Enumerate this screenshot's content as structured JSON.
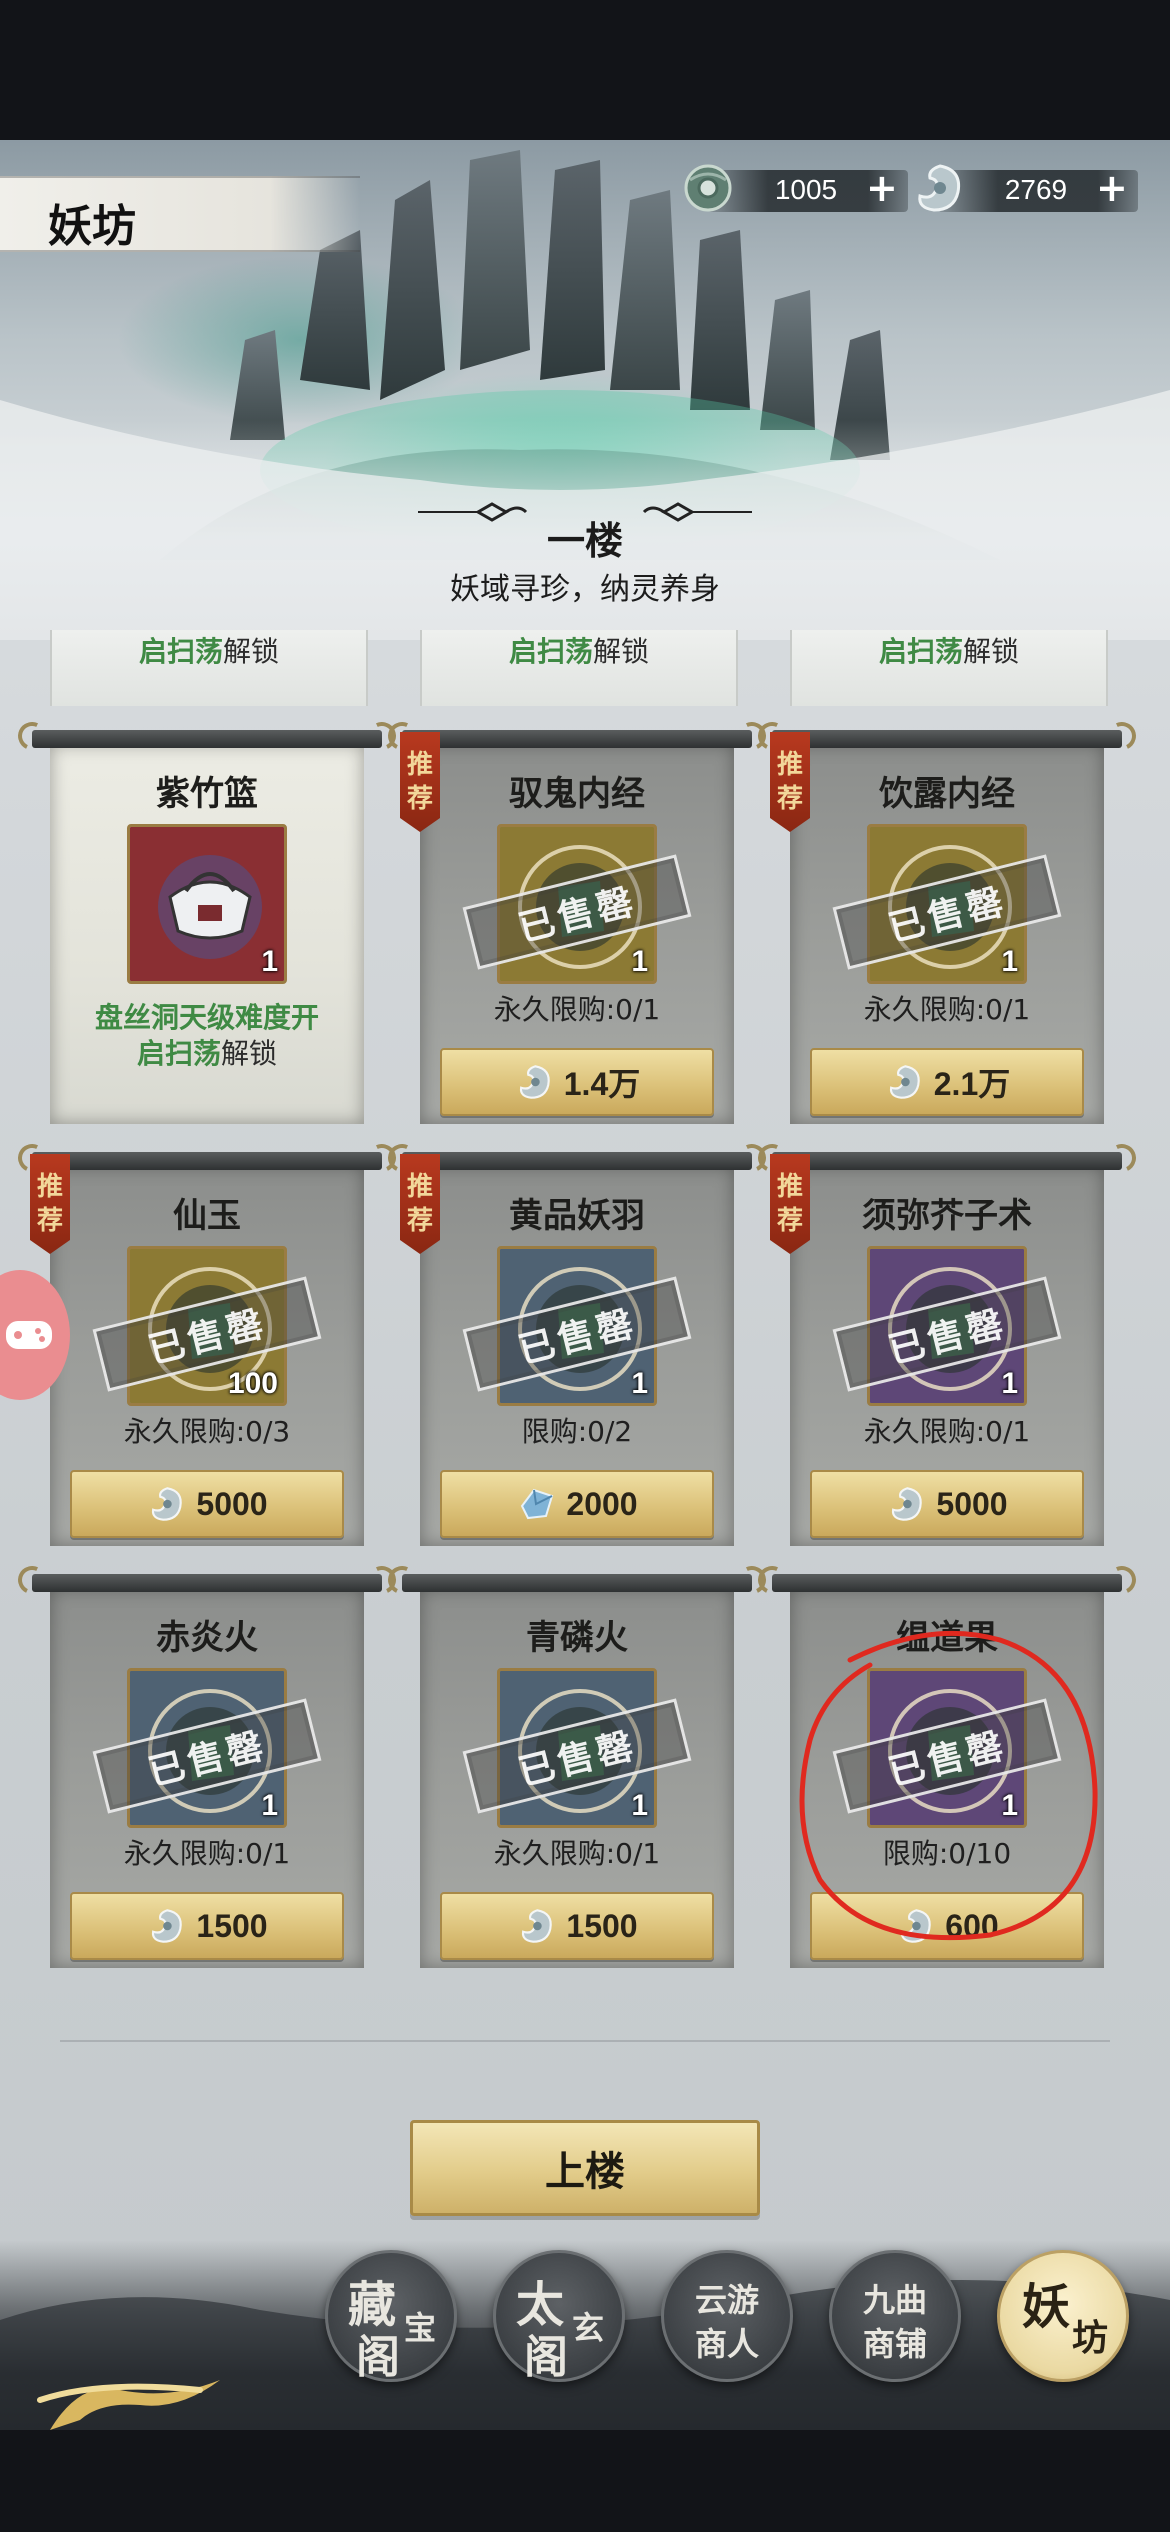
{
  "header": {
    "title": "妖坊",
    "currencies": [
      {
        "icon": "jade-ring-icon",
        "value": "1005",
        "plus": "+"
      },
      {
        "icon": "spirit-pendant-icon",
        "value": "2769",
        "plus": "+"
      }
    ]
  },
  "floor": {
    "name": "一楼",
    "subtitle": "妖域寻珍，纳灵养身"
  },
  "partial_row": [
    {
      "green": "启扫荡",
      "rest": "解锁"
    },
    {
      "green": "启扫荡",
      "rest": "解锁"
    },
    {
      "green": "启扫荡",
      "rest": "解锁"
    }
  ],
  "ribbon_text": [
    "推",
    "荐"
  ],
  "sold_stamp": "已售罄",
  "items": [
    {
      "name": "紫竹篮",
      "qty": "1",
      "unlock_green": "盘丝洞天级难度开",
      "unlock_green2": "启扫荡",
      "unlock_rest": "解锁",
      "sold": false,
      "recommended": false,
      "light": true,
      "icon": "bamboo-basket-icon",
      "color": "#8a2f33"
    },
    {
      "name": "驭鬼内经",
      "qty": "1",
      "limit": "永久限购:0/1",
      "price": "1.4万",
      "currency_icon": "spirit-pendant-icon",
      "sold": true,
      "recommended": true,
      "icon": "scripture-book-icon",
      "color": "#8c7a34"
    },
    {
      "name": "饮露内经",
      "qty": "1",
      "limit": "永久限购:0/1",
      "price": "2.1万",
      "currency_icon": "spirit-pendant-icon",
      "sold": true,
      "recommended": true,
      "icon": "scripture-book-icon",
      "color": "#8c7a34"
    },
    {
      "name": "仙玉",
      "qty": "100",
      "limit": "永久限购:0/3",
      "price": "5000",
      "currency_icon": "spirit-pendant-icon",
      "sold": true,
      "recommended": true,
      "icon": "jade-ring-icon",
      "color": "#8c7a34"
    },
    {
      "name": "黄品妖羽",
      "qty": "1",
      "limit": "限购:0/2",
      "price": "2000",
      "currency_icon": "blue-crystal-icon",
      "sold": true,
      "recommended": true,
      "icon": "feather-icon",
      "color": "#4f6273"
    },
    {
      "name": "须弥芥子术",
      "qty": "1",
      "limit": "永久限购:0/1",
      "price": "5000",
      "currency_icon": "spirit-pendant-icon",
      "sold": true,
      "recommended": true,
      "icon": "mustard-seed-icon",
      "color": "#5e4777"
    },
    {
      "name": "赤炎火",
      "qty": "1",
      "limit": "永久限购:0/1",
      "price": "1500",
      "currency_icon": "spirit-pendant-icon",
      "sold": true,
      "recommended": false,
      "icon": "red-flame-icon",
      "color": "#4f6273"
    },
    {
      "name": "青磷火",
      "qty": "1",
      "limit": "永久限购:0/1",
      "price": "1500",
      "currency_icon": "spirit-pendant-icon",
      "sold": true,
      "recommended": false,
      "icon": "blue-flame-icon",
      "color": "#4f6273"
    },
    {
      "name": "缊道果",
      "qty": "1",
      "limit": "限购:0/10",
      "price": "600",
      "currency_icon": "spirit-pendant-icon",
      "sold": true,
      "recommended": false,
      "icon": "dao-fruit-icon",
      "color": "#5e4777"
    }
  ],
  "up_button": "上楼",
  "nav": [
    {
      "id": "cangbao",
      "big": "藏",
      "small": "宝",
      "big2": "阁"
    },
    {
      "id": "taixuan",
      "big": "太",
      "small": "玄",
      "big2": "阁"
    },
    {
      "id": "yunyou",
      "line1": "云游",
      "line2": "商人"
    },
    {
      "id": "jiuqu",
      "line1": "九曲",
      "line2": "商铺"
    },
    {
      "id": "yaofang",
      "big": "妖",
      "small": "坊"
    }
  ],
  "colors": {
    "accent_gold": "#dcc27a",
    "unlock_green": "#3f8a44",
    "annotation_red": "#e0291f"
  }
}
